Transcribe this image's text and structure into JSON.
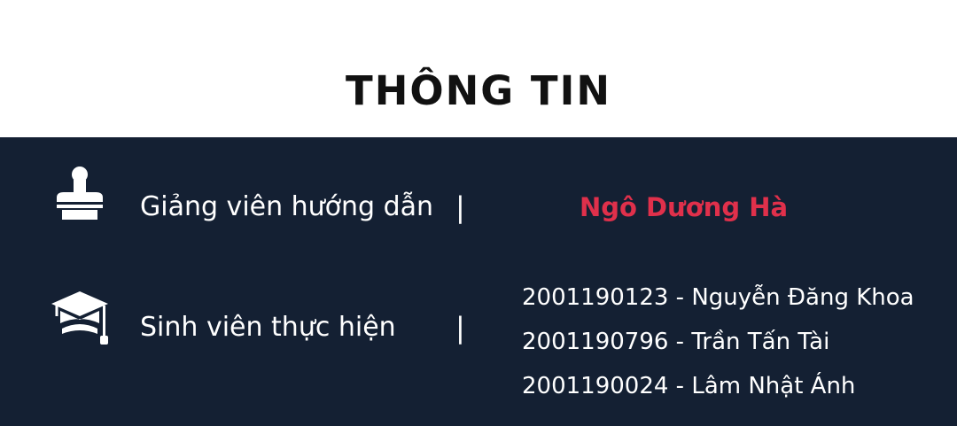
{
  "page": {
    "title": "THÔNG TIN"
  },
  "advisor": {
    "icon": "stamp-icon",
    "label": "Giảng viên hướng dẫn",
    "separator": "|",
    "name": "Ngô Dương Hà"
  },
  "students": {
    "icon": "graduation-cap-icon",
    "label": "Sinh viên thực hiện",
    "separator": "|",
    "list": [
      "2001190123 - Nguyễn Đăng Khoa",
      "2001190796 - Trần Tấn Tài",
      "2001190024 - Lâm Nhật Ánh"
    ]
  },
  "colors": {
    "panel_background": "#142033",
    "accent": "#e0304b",
    "title_text": "#111111",
    "panel_text": "#ffffff"
  }
}
